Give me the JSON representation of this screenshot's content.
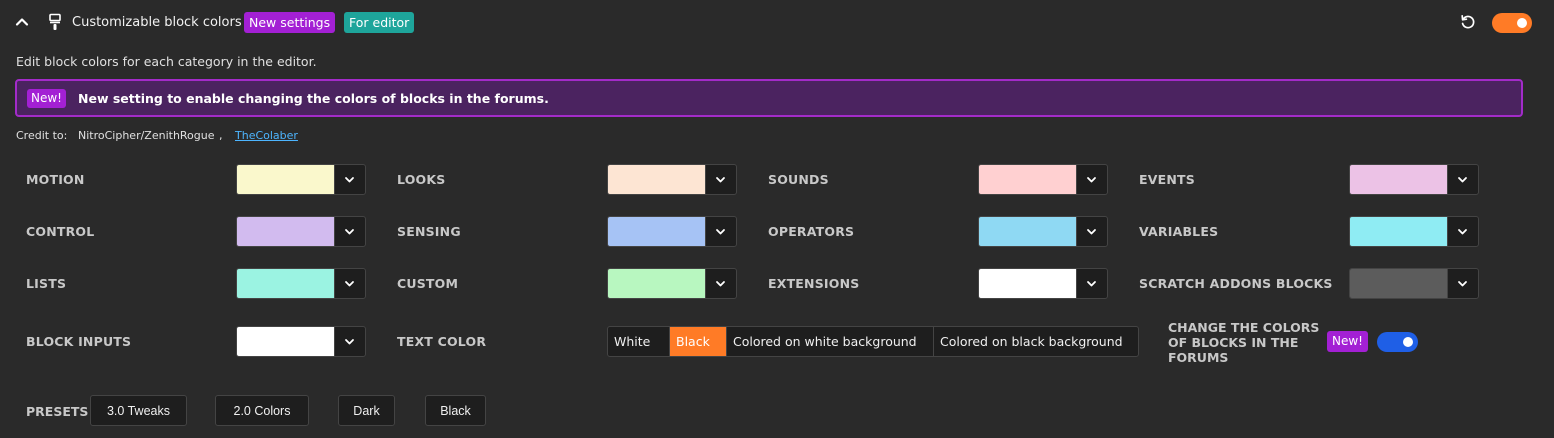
{
  "header": {
    "title": "Customizable block colors",
    "badge_new": "New settings",
    "badge_editor": "For editor",
    "enabled": true,
    "icons": {
      "collapse": "chevron-up-icon",
      "addon": "paintbrush-icon",
      "reset": "reset-icon"
    }
  },
  "description": "Edit block colors for each category in the editor.",
  "notice": {
    "badge": "New!",
    "text": "New setting to enable changing the colors of blocks in the forums."
  },
  "credits": {
    "label": "Credit to:",
    "user1": "NitroCipher/ZenithRogue",
    "separator": ",",
    "user2": "TheColaber"
  },
  "categories": [
    {
      "label": "MOTION",
      "color": "#faf8cc"
    },
    {
      "label": "LOOKS",
      "color": "#fde5d3"
    },
    {
      "label": "SOUNDS",
      "color": "#ffd0d1"
    },
    {
      "label": "EVENTS",
      "color": "#ecc2e6"
    },
    {
      "label": "CONTROL",
      "color": "#d2bbef"
    },
    {
      "label": "SENSING",
      "color": "#a6c3f5"
    },
    {
      "label": "OPERATORS",
      "color": "#8fd9f3"
    },
    {
      "label": "VARIABLES",
      "color": "#8fecf3"
    },
    {
      "label": "LISTS",
      "color": "#9bf3e2"
    },
    {
      "label": "CUSTOM",
      "color": "#b8f7c0"
    },
    {
      "label": "EXTENSIONS",
      "color": "#ffffff"
    },
    {
      "label": "SCRATCH ADDONS BLOCKS",
      "color": "#5c5c5c"
    },
    {
      "label": "BLOCK INPUTS",
      "color": "#ffffff"
    }
  ],
  "text_color": {
    "label": "TEXT COLOR",
    "options": [
      "White",
      "Black",
      "Colored on white background",
      "Colored on black background"
    ],
    "selected": "Black"
  },
  "forums": {
    "label": "CHANGE THE COLORS OF BLOCKS IN THE FORUMS",
    "badge": "New!",
    "enabled": true
  },
  "presets": {
    "label": "PRESETS",
    "buttons": [
      "3.0 Tweaks",
      "2.0 Colors",
      "Dark",
      "Black"
    ]
  },
  "colors": {
    "background": "#2a2a2a",
    "accent_orange": "#ff7b26",
    "accent_purple": "#a320d4",
    "accent_teal": "#1ea59b",
    "toggle_blue": "#1f5fe6",
    "link": "#4db5ff"
  }
}
